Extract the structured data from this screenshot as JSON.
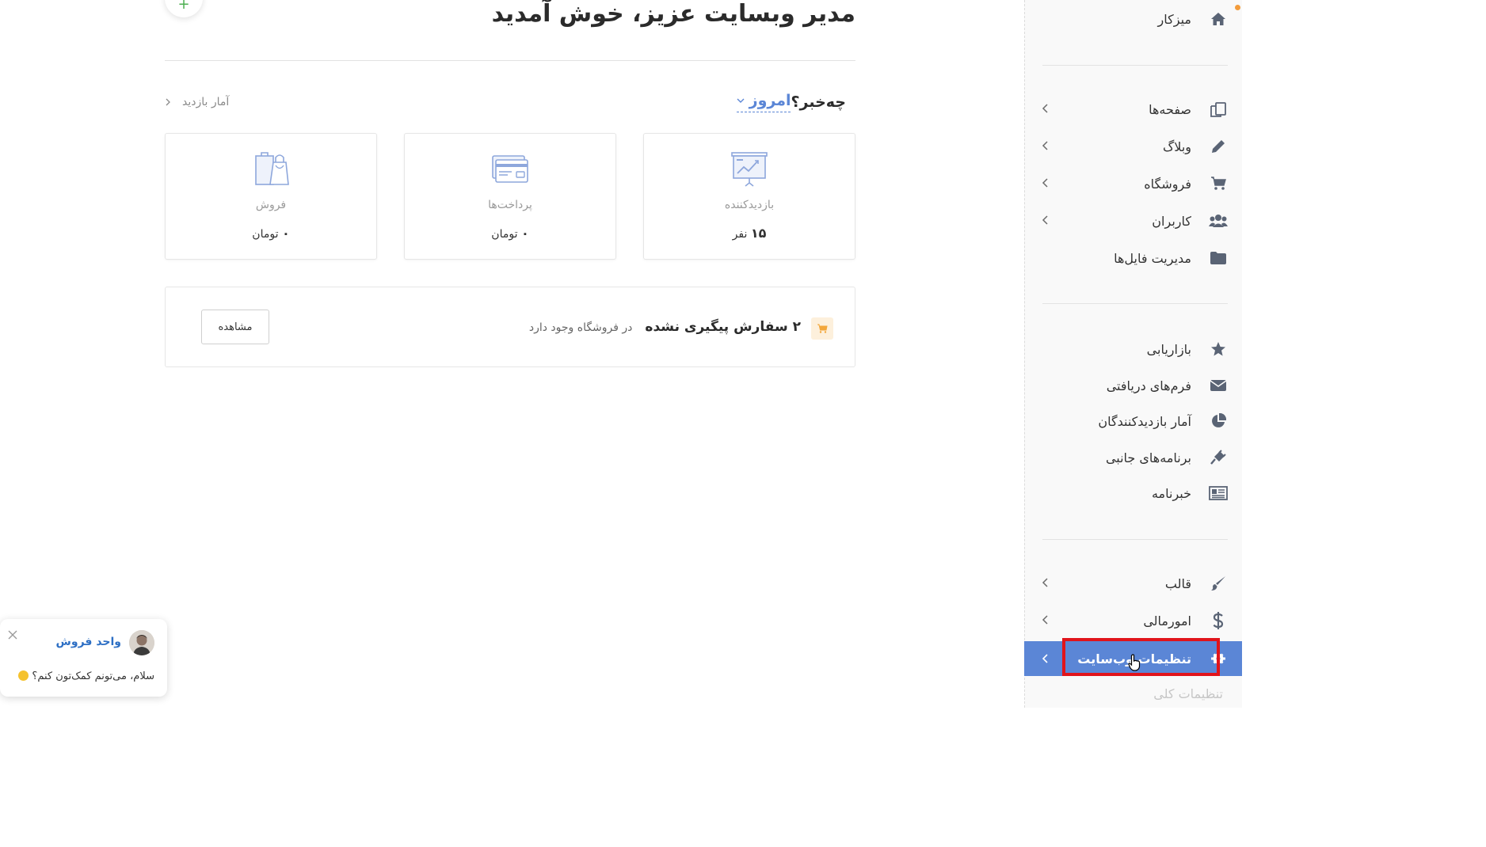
{
  "page": {
    "title": "مدیر وبسایت عزیز، خوش آمدید",
    "fab_label": "+"
  },
  "summary": {
    "period": "امروز",
    "heading": "چه‌خبر؟",
    "stats_link": "آمار بازدید"
  },
  "cards": [
    {
      "icon": "presentation-chart-icon",
      "title": "بازدیدکننده",
      "value": "۱۵",
      "unit": "نفر"
    },
    {
      "icon": "credit-card-icon",
      "title": "پرداخت‌ها",
      "value": "۰",
      "unit": "تومان"
    },
    {
      "icon": "shopping-bags-icon",
      "title": "فروش",
      "value": "۰",
      "unit": "تومان"
    }
  ],
  "orders": {
    "icon": "cart-icon",
    "bold_text": "۲ سفارش پیگیری نشده",
    "rest_text": "در فروشگاه وجود دارد",
    "button": "مشاهده"
  },
  "sidebar": {
    "items": [
      {
        "label": "میزکار",
        "icon": "home-icon",
        "arrow": false
      },
      {
        "label": "صفحه‌ها",
        "icon": "pages-icon",
        "arrow": true
      },
      {
        "label": "وبلاگ",
        "icon": "pencil-icon",
        "arrow": true
      },
      {
        "label": "فروشگاه",
        "icon": "cart-icon",
        "arrow": true
      },
      {
        "label": "کاربران",
        "icon": "users-icon",
        "arrow": true
      },
      {
        "label": "مدیریت فایل‌ها",
        "icon": "folder-icon",
        "arrow": false
      },
      {
        "label": "بازاریابی",
        "icon": "star-icon",
        "arrow": false
      },
      {
        "label": "فرم‌های دریافتی",
        "icon": "envelope-icon",
        "arrow": false
      },
      {
        "label": "آمار بازدیدکنندگان",
        "icon": "pie-chart-icon",
        "arrow": false
      },
      {
        "label": "برنامه‌های جانبی",
        "icon": "plug-icon",
        "arrow": false
      },
      {
        "label": "خبرنامه",
        "icon": "newspaper-icon",
        "arrow": false
      },
      {
        "label": "قالب",
        "icon": "brush-icon",
        "arrow": true
      },
      {
        "label": "امورمالی",
        "icon": "dollar-icon",
        "arrow": true
      },
      {
        "label": "تنظیمات وب‌سایت",
        "icon": "gear-icon",
        "arrow": true,
        "active": true
      }
    ],
    "sub_item": "تنظیمات کلی"
  },
  "chat": {
    "agent": "واحد فروش",
    "message": "سلام، می‌تونم کمک‌تون کنم؟"
  },
  "colors": {
    "accent": "#5b86d6",
    "highlight": "#e1141b",
    "cart_badge": "#fdf0dc"
  }
}
